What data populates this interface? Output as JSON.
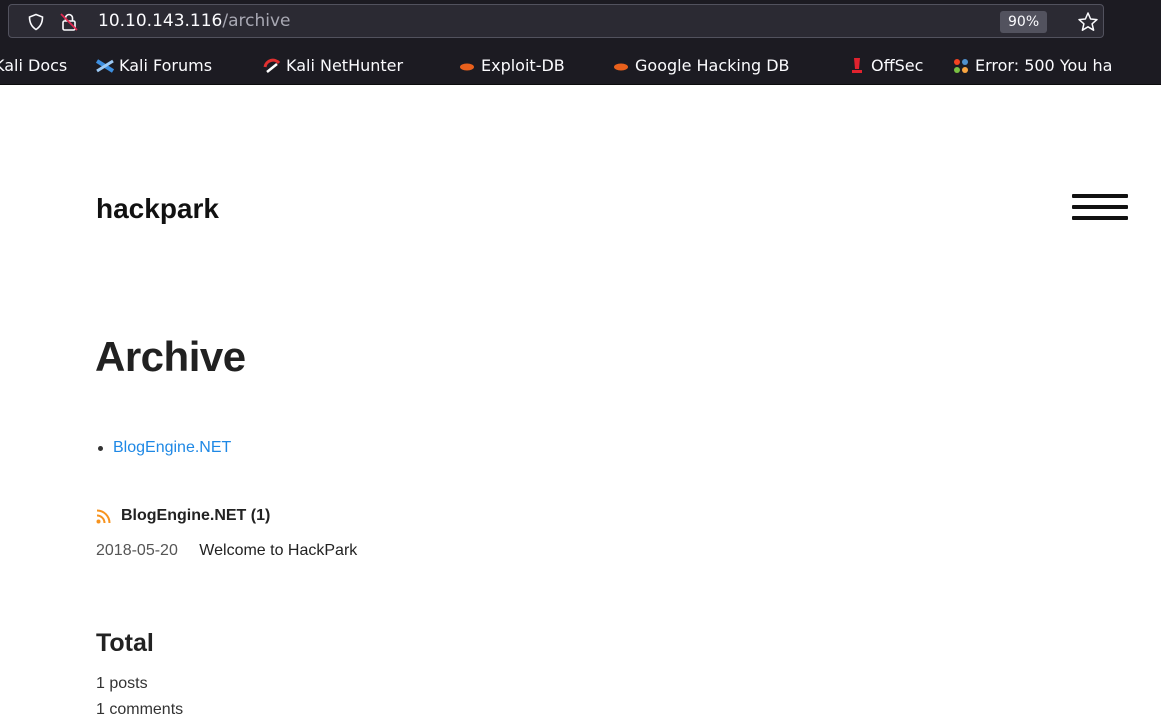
{
  "browser": {
    "url_host": "10.10.143.116",
    "url_path": "/archive",
    "zoom": "90%",
    "bookmarks": [
      {
        "label": "Kali Docs",
        "icon": "kali-docs-icon"
      },
      {
        "label": "Kali Forums",
        "icon": "kali-forums-icon"
      },
      {
        "label": "Kali NetHunter",
        "icon": "kali-nethunter-icon"
      },
      {
        "label": "Exploit-DB",
        "icon": "exploit-db-icon"
      },
      {
        "label": "Google Hacking DB",
        "icon": "ghdb-icon"
      },
      {
        "label": "OffSec",
        "icon": "offsec-icon"
      },
      {
        "label": "Error: 500 You ha",
        "icon": "joomla-icon"
      }
    ]
  },
  "site": {
    "title": "hackpark"
  },
  "page": {
    "title": "Archive",
    "categories": [
      "BlogEngine.NET"
    ],
    "category_section": {
      "heading": "BlogEngine.NET (1)",
      "posts": [
        {
          "date": "2018-05-20",
          "title": "Welcome to HackPark"
        }
      ]
    },
    "total": {
      "heading": "Total",
      "posts": "1 posts",
      "comments": "1 comments"
    }
  },
  "colors": {
    "link": "#1e88e5",
    "rss": "#f7931e",
    "chrome_bg": "#1c1b22"
  }
}
